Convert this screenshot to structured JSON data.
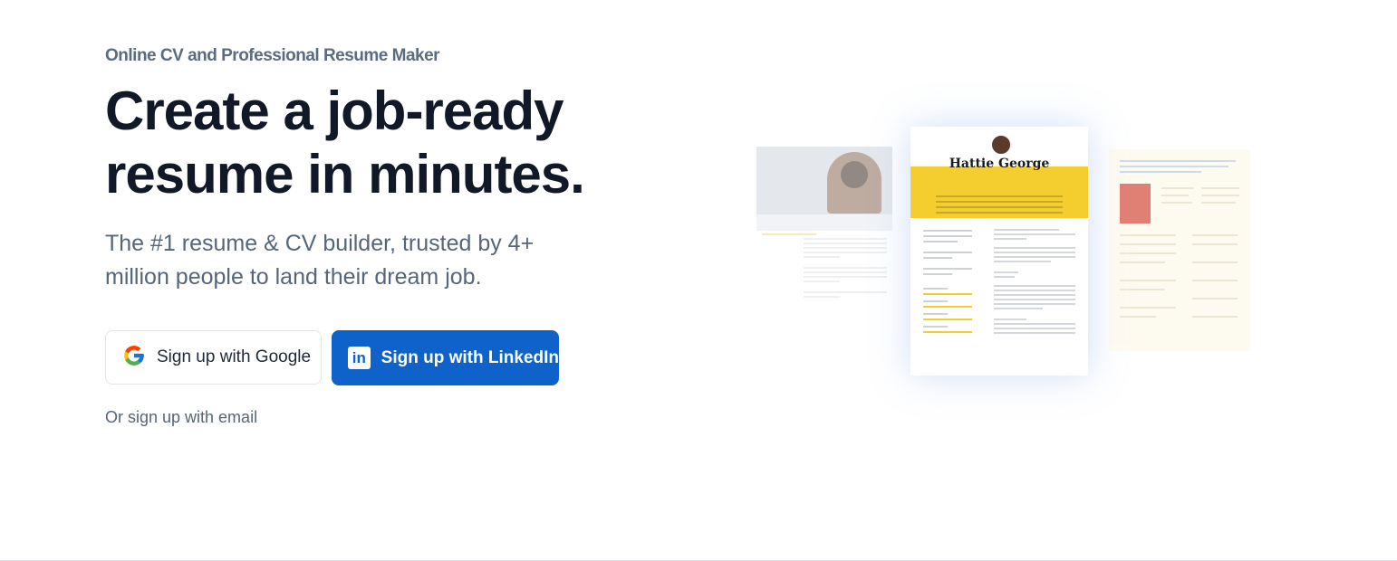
{
  "hero": {
    "eyebrow": "Online CV and Professional Resume Maker",
    "headline_line1": "Create a job-ready",
    "headline_line2": "resume in minutes.",
    "subhead": "The #1 resume & CV builder, trusted by 4+ million people to land their dream job."
  },
  "buttons": {
    "google_label": "Sign up with Google",
    "linkedin_label": "Sign up with LinkedIn",
    "email_link": "Or sign up with email"
  },
  "icons": {
    "google": "google-logo-icon",
    "linkedin": "linkedin-logo-icon"
  },
  "preview": {
    "main_name": "Hattie George"
  },
  "colors": {
    "linkedin_blue": "#0e62c9",
    "resume_yellow": "#f4cd2e",
    "heading": "#111827",
    "muted": "#56657a"
  }
}
